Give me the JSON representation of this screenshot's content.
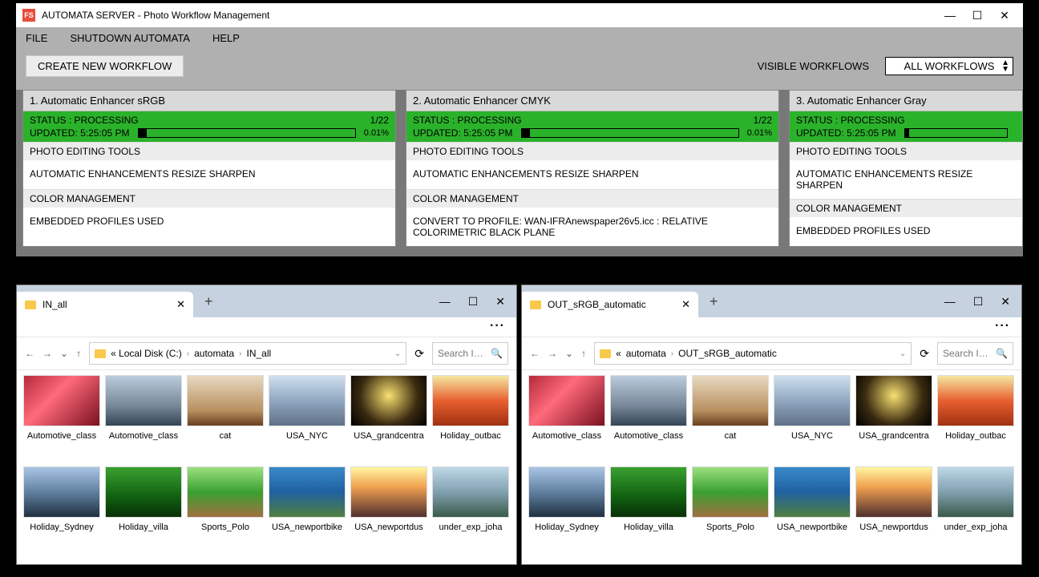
{
  "app": {
    "title": "AUTOMATA SERVER - Photo Workflow Management",
    "icon_text": "FS",
    "menu": {
      "file": "FILE",
      "shutdown": "SHUTDOWN AUTOMATA",
      "help": "HELP"
    },
    "create_btn": "CREATE NEW WORKFLOW",
    "visible_label": "VISIBLE WORKFLOWS",
    "visible_value": "ALL WORKFLOWS"
  },
  "wf": [
    {
      "title": "1. Automatic Enhancer sRGB",
      "status": "STATUS : PROCESSING",
      "progress_text": "1/22",
      "updated": "UPDATED: 5:25:05 PM",
      "pct": "0.01%",
      "tools_h": "PHOTO EDITING TOOLS",
      "tools_b": "AUTOMATIC ENHANCEMENTS  RESIZE  SHARPEN",
      "color_h": "COLOR MANAGEMENT",
      "color_b": "EMBEDDED PROFILES USED"
    },
    {
      "title": "2. Automatic Enhancer CMYK",
      "status": "STATUS : PROCESSING",
      "progress_text": "1/22",
      "updated": "UPDATED: 5:25:05 PM",
      "pct": "0.01%",
      "tools_h": "PHOTO EDITING TOOLS",
      "tools_b": "AUTOMATIC ENHANCEMENTS  RESIZE  SHARPEN",
      "color_h": "COLOR MANAGEMENT",
      "color_b": "CONVERT TO PROFILE: WAN-IFRAnewspaper26v5.icc : RELATIVE COLORIMETRIC BLACK PLANE"
    },
    {
      "title": "3. Automatic Enhancer Gray",
      "status": "STATUS : PROCESSING",
      "progress_text": "",
      "updated": "UPDATED: 5:25:05 PM",
      "pct": "",
      "tools_h": "PHOTO EDITING TOOLS",
      "tools_b": "AUTOMATIC ENHANCEMENTS  RESIZE  SHARPEN",
      "color_h": "COLOR MANAGEMENT",
      "color_b": "EMBEDDED PROFILES USED"
    }
  ],
  "exp_left": {
    "tab": "IN_all",
    "crumb_prefix": "«  Local Disk (C:)",
    "crumb_mid": "automata",
    "crumb_leaf": "IN_all",
    "search_ph": "Search I…"
  },
  "exp_right": {
    "tab": "OUT_sRGB_automatic",
    "crumb_prefix": "«",
    "crumb_mid": "automata",
    "crumb_leaf": "OUT_sRGB_automatic",
    "search_ph": "Search I…"
  },
  "files": [
    {
      "name": "Automotive_class",
      "th": "t-red"
    },
    {
      "name": "Automotive_class",
      "th": "t-car"
    },
    {
      "name": "cat",
      "th": "t-cat"
    },
    {
      "name": "USA_NYC",
      "th": "t-nyc"
    },
    {
      "name": "USA_grandcentra",
      "th": "t-gc"
    },
    {
      "name": "Holiday_outbac",
      "th": "t-bal"
    },
    {
      "name": "Holiday_Sydney",
      "th": "t-syd"
    },
    {
      "name": "Holiday_villa",
      "th": "t-villa"
    },
    {
      "name": "Sports_Polo",
      "th": "t-polo"
    },
    {
      "name": "USA_newportbike",
      "th": "t-bike"
    },
    {
      "name": "USA_newportdus",
      "th": "t-dusk"
    },
    {
      "name": "under_exp_joha",
      "th": "t-joh"
    }
  ]
}
